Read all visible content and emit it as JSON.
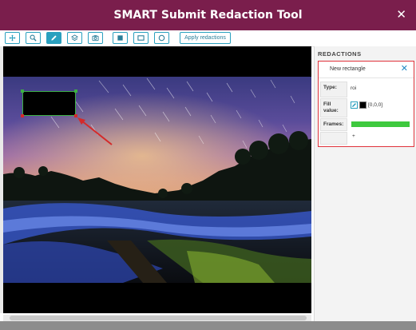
{
  "window": {
    "title": "SMART Submit Redaction Tool",
    "close_glyph": "✕"
  },
  "toolbar": {
    "tools": [
      {
        "name": "move-tool-button",
        "icon": "move-arrows-icon",
        "active": false
      },
      {
        "name": "zoom-tool-button",
        "icon": "magnifier-icon",
        "active": false
      },
      {
        "name": "pencil-tool-button",
        "icon": "pencil-icon",
        "active": true
      },
      {
        "name": "layers-tool-button",
        "icon": "layers-icon",
        "active": false
      },
      {
        "name": "snapshot-tool-button",
        "icon": "camera-icon",
        "active": false
      },
      {
        "name": "filled-rect-tool-button",
        "icon": "filled-square-icon",
        "active": false
      },
      {
        "name": "rect-tool-button",
        "icon": "outline-rectangle-icon",
        "active": false
      },
      {
        "name": "ellipse-tool-button",
        "icon": "circle-icon",
        "active": false
      }
    ],
    "apply_label": "Apply redactions"
  },
  "redactions_panel": {
    "title": "REDACTIONS",
    "item": {
      "name": "New rectangle",
      "close_glyph": "✕",
      "type_label": "Type:",
      "type_value": "roi",
      "fill_label_1": "Fill",
      "fill_label_2": "value:",
      "fill_value": "[0,0,0]",
      "fill_color": "#000000",
      "frames_label": "Frames:",
      "frames_color": "#3ec93e",
      "extra_mark": "+"
    }
  },
  "colors": {
    "titlebar": "#7a1e4c",
    "accent": "#2aa0bf",
    "highlight_border": "#e0333b",
    "annotation_arrow": "#d42a2a",
    "selection_border": "#3cb043"
  }
}
